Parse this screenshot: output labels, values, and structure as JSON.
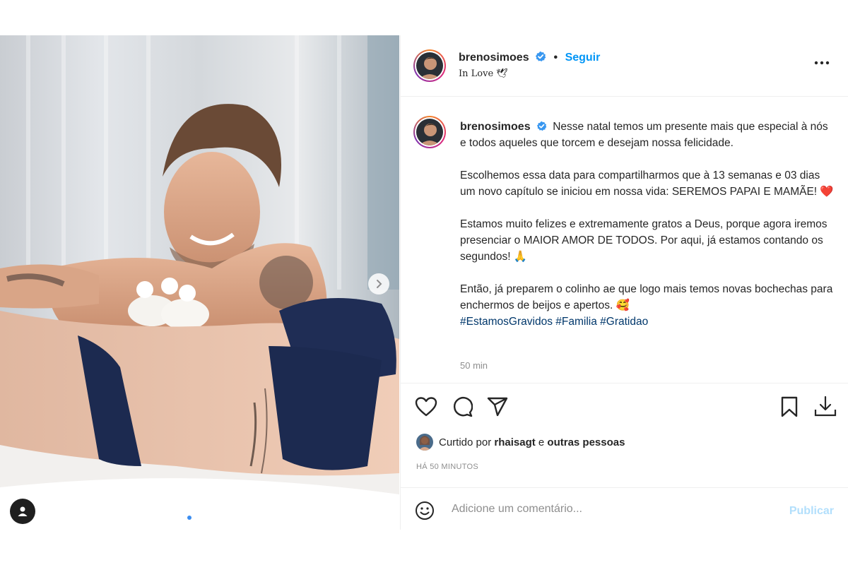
{
  "post": {
    "author": {
      "username": "brenosimoes",
      "verified": true,
      "follow_label": "Seguir",
      "location": "In Love 🕊"
    },
    "caption": {
      "paragraphs": [
        "Nesse natal temos um presente mais que especial à nós e todos aqueles que torcem e desejam nossa felicidade.",
        "Escolhemos essa data para compartilharmos que à 13 semanas e 03 dias um novo capítulo se iniciou em nossa vida: SEREMOS PAPAI E MAMÃE!",
        "Estamos muito felizes e extremamente gratos a Deus, porque agora iremos presenciar o MAIOR AMOR DE TODOS. Por aqui, já estamos contando os segundos!",
        "Então, já preparem o colinho ae que logo mais temos novas bochechas para enchermos de beijos e apertos."
      ],
      "emojis": [
        "❤️",
        "🙏",
        "🥰"
      ],
      "hashtags": [
        "#EstamosGravidos",
        "#Familia",
        "#Gratidao"
      ],
      "time_ago": "50 min"
    },
    "likes": {
      "prefix": "Curtido por",
      "user": "rhaisagt",
      "connector": "e",
      "others": "outras pessoas"
    },
    "posted_ago": "HÁ 50 MINUTOS",
    "comment": {
      "placeholder": "Adicione um comentário...",
      "publish_label": "Publicar"
    },
    "carousel": {
      "current": 1,
      "total": 3
    }
  },
  "icons": {
    "verified": "verified-badge-icon",
    "more": "more-options-icon",
    "like": "heart-icon",
    "comment": "comment-icon",
    "share": "send-icon",
    "save": "bookmark-icon",
    "download": "download-icon",
    "emoji": "smiley-icon",
    "next": "chevron-right-icon",
    "tag": "user-tag-icon"
  },
  "colors": {
    "accent": "#0095f6",
    "hashtag": "#00376b",
    "muted": "#8e8e8e",
    "publish_disabled": "#b2dffc"
  }
}
